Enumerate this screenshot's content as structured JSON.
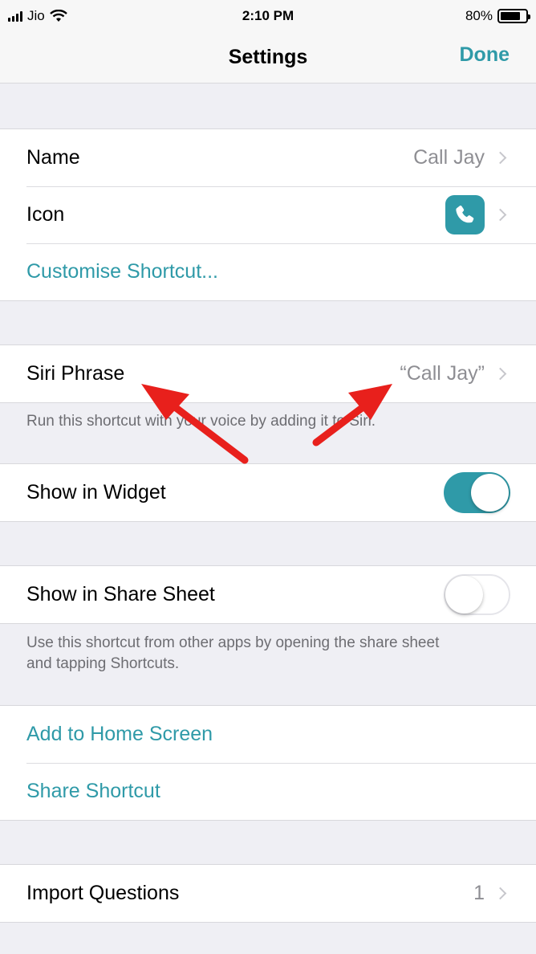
{
  "status_bar": {
    "carrier": "Jio",
    "time": "2:10 PM",
    "battery": "80%",
    "battery_level": 0.8
  },
  "nav": {
    "title": "Settings",
    "done_label": "Done"
  },
  "group1": {
    "name_label": "Name",
    "name_value": "Call Jay",
    "icon_label": "Icon",
    "icon_name": "phone-icon",
    "customise_label": "Customise Shortcut..."
  },
  "siri": {
    "label": "Siri Phrase",
    "value": "“Call Jay”",
    "note": "Run this shortcut with your voice by adding it to Siri."
  },
  "widget": {
    "label": "Show in Widget",
    "on": true
  },
  "share_sheet": {
    "label": "Show in Share Sheet",
    "on": false,
    "note_line1": "Use this shortcut from other apps by opening the share sheet",
    "note_line2": "and tapping Shortcuts."
  },
  "actions": {
    "home_label": "Add to Home Screen",
    "share_label": "Share Shortcut"
  },
  "import": {
    "label": "Import Questions",
    "value": "1"
  },
  "colors": {
    "accent": "#2f9aa8",
    "arrow": "#e8201c",
    "background": "#efeff4"
  }
}
